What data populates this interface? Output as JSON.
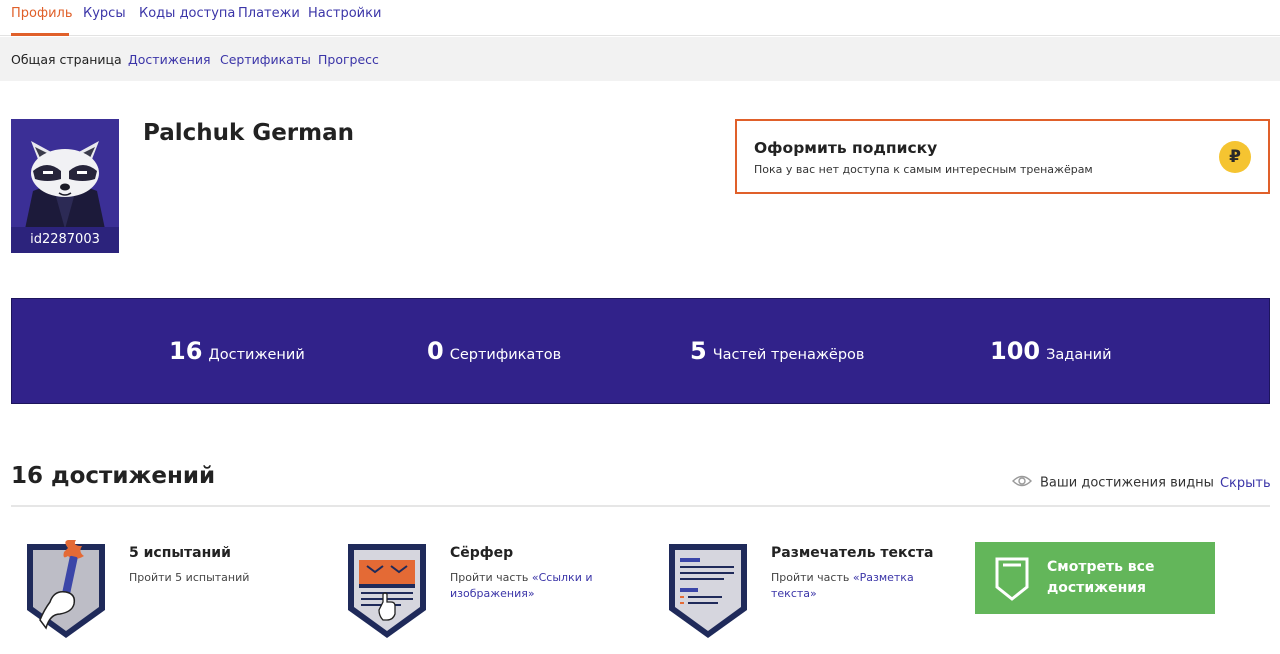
{
  "nav": {
    "tabs": [
      "Профиль",
      "Курсы",
      "Коды доступа",
      "Платежи",
      "Настройки"
    ]
  },
  "subnav": {
    "items": [
      "Общая страница",
      "Достижения",
      "Сертификаты",
      "Прогресс"
    ]
  },
  "profile": {
    "name": "Palchuk German",
    "user_id": "id2287003"
  },
  "subscription": {
    "title": "Оформить подписку",
    "text": "Пока у вас нет доступа к самым интересным тренажёрам",
    "icon": "ruble-coin-icon",
    "icon_glyph": "₽"
  },
  "stats": [
    {
      "value": "16",
      "label": "Достижений"
    },
    {
      "value": "0",
      "label": "Сертификатов"
    },
    {
      "value": "5",
      "label": "Частей тренажёров"
    },
    {
      "value": "100",
      "label": "Заданий"
    }
  ],
  "achievements": {
    "heading": "16 достижений",
    "visibility_text": "Ваши достижения видны",
    "hide_label": "Скрыть",
    "items": [
      {
        "title": "5 испытаний",
        "desc": "Пройти 5 испытаний",
        "desc_prefix": "",
        "desc_link": ""
      },
      {
        "title": "Сёрфер",
        "desc": "",
        "desc_prefix": "Пройти часть ",
        "desc_link": "«Ссылки и изображения»"
      },
      {
        "title": "Размечатель текста",
        "desc": "",
        "desc_prefix": "Пройти часть ",
        "desc_link": "«Разметка текста»"
      }
    ],
    "see_all_label": "Смотреть все достижения"
  },
  "colors": {
    "accent": "#e0602a",
    "link": "#3b35a8",
    "banner": "#31228a",
    "see_all": "#63b65a",
    "coin": "#f5c431"
  }
}
